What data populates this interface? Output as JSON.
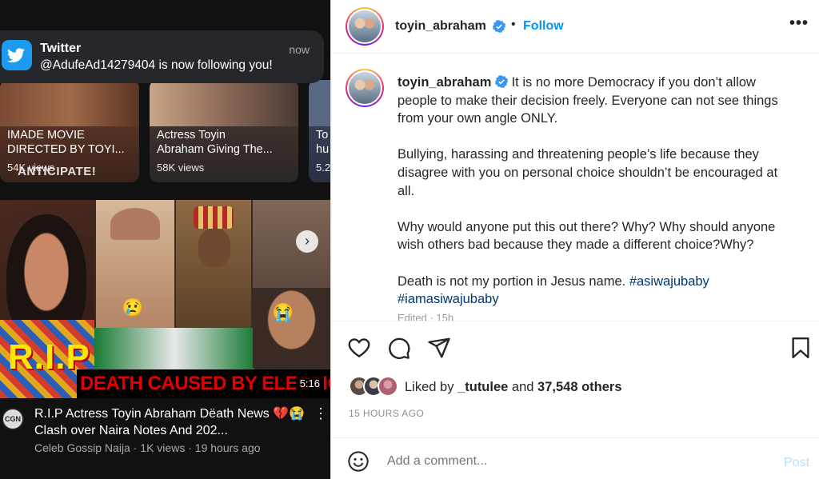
{
  "notification": {
    "app": "Twitter",
    "time": "now",
    "message": "@AdufeAd14279404 is now following you!"
  },
  "thumbnails": [
    {
      "title1": "IMADE MOVIE",
      "title2": "DIRECTED BY TOYI...",
      "views": "54K views",
      "overlay": "ANTICIPATE!"
    },
    {
      "title1": "Actress Toyin",
      "title2": "Abraham Giving The...",
      "views": "58K views"
    },
    {
      "title1": "To",
      "title2": "hu",
      "views": "5.2"
    }
  ],
  "video": {
    "rip_text": "R.I.P",
    "banner": "DEATH CAUSED BY ELECTION",
    "duration": "5:16",
    "title": "R.I.P Actress Toyin Abraham Dëath News 💔😭 Clash over Naira Notes And 202...",
    "channel": "Celeb Gossip Naija",
    "views": "1K views",
    "age": "19 hours ago",
    "channel_initials": "CGN"
  },
  "post": {
    "username": "toyin_abraham",
    "follow_label": "Follow",
    "dot": "•",
    "more": "•••",
    "caption": [
      "It is no more Democracy if you don’t allow people to make their decision freely. Everyone can not see things from your own angle ONLY.",
      "Bullying, harassing and threatening people’s life because they disagree with you on personal choice shouldn’t be encouraged at all.",
      "Why would anyone put this out there? Why? Why should anyone wish others bad because they made a different choice?Why?"
    ],
    "last_line": "Death is not my portion in Jesus name.",
    "hashtags": [
      "#asiwajubaby",
      "#iamasiwajubaby"
    ],
    "edited": "Edited · 15h",
    "liked_by_prefix": "Liked by",
    "liked_by_user": "_tutulee",
    "liked_by_and": "and",
    "likes_others": "37,548 others",
    "timestamp": "15 HOURS AGO",
    "comment_placeholder": "Add a comment...",
    "post_label": "Post"
  },
  "colors": {
    "follow": "#0095f6",
    "hashtag": "#00376b",
    "post_disabled": "#b2dffc",
    "twitter": "#1d9bf0"
  },
  "icons": [
    "twitter-icon",
    "verified-badge-icon",
    "more-options-icon",
    "heart-icon",
    "comment-icon",
    "share-icon",
    "bookmark-icon",
    "emoji-icon"
  ]
}
